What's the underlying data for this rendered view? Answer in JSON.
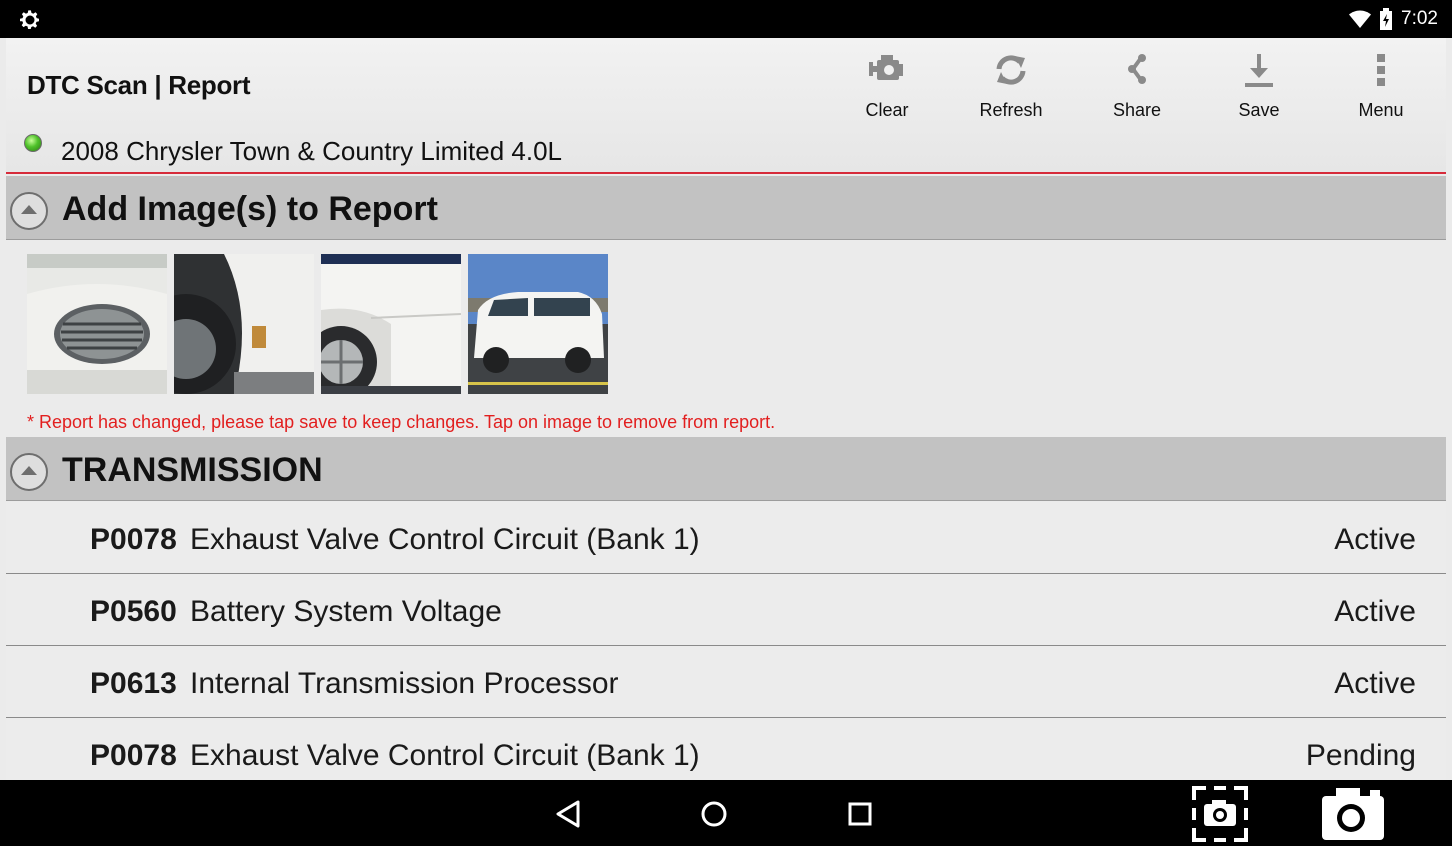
{
  "status_bar": {
    "time": "7:02",
    "icons": [
      "settings-gear-icon",
      "wifi-icon",
      "battery-icon"
    ]
  },
  "header": {
    "title": "DTC Scan | Report",
    "vehicle": "2008 Chrysler Town & Country Limited 4.0L",
    "connection_status_color": "#4fc22a",
    "accent_color": "#d62b3a"
  },
  "toolbar": {
    "clear_label": "Clear",
    "refresh_label": "Refresh",
    "share_label": "Share",
    "save_label": "Save",
    "menu_label": "Menu"
  },
  "images_section": {
    "title": "Add Image(s) to Report",
    "thumbnails": [
      "vehicle-front-grille-photo",
      "vehicle-front-wheel-photo",
      "vehicle-side-wheel-photo",
      "vehicle-side-view-photo"
    ],
    "notice": "* Report has changed, please tap save to keep changes. Tap on image to remove from report."
  },
  "transmission_section": {
    "title": "TRANSMISSION",
    "dtcs": [
      {
        "code": "P0078",
        "description": "Exhaust Valve Control Circuit (Bank 1)",
        "status": "Active"
      },
      {
        "code": "P0560",
        "description": "Battery System Voltage",
        "status": "Active"
      },
      {
        "code": "P0613",
        "description": "Internal Transmission Processor",
        "status": "Active"
      },
      {
        "code": "P0078",
        "description": "Exhaust Valve Control Circuit (Bank 1)",
        "status": "Pending"
      }
    ]
  },
  "navbar": {
    "icons": [
      "back-icon",
      "home-icon",
      "recents-icon",
      "screenshot-icon",
      "camera-icon"
    ]
  }
}
